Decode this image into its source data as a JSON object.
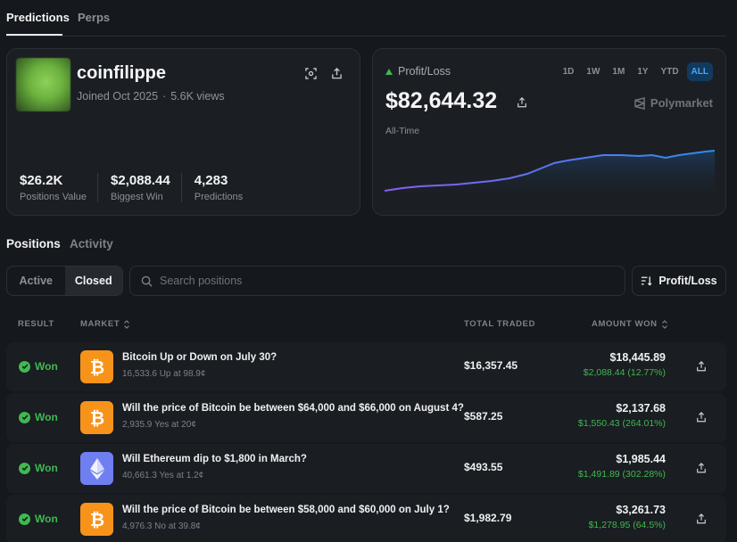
{
  "tabs": [
    {
      "label": "Predictions"
    },
    {
      "label": "Perps"
    }
  ],
  "profile": {
    "username": "coinfilippe",
    "joined": "Joined Oct 2025",
    "views": "5.6K views",
    "stats": [
      {
        "value": "$26.2K",
        "label": "Positions Value"
      },
      {
        "value": "$2,088.44",
        "label": "Biggest Win"
      },
      {
        "value": "4,283",
        "label": "Predictions"
      }
    ]
  },
  "pnl": {
    "label": "Profit/Loss",
    "value": "$82,644.32",
    "period": "All-Time",
    "brand": "Polymarket",
    "ranges": [
      "1D",
      "1W",
      "1M",
      "1Y",
      "YTD",
      "ALL"
    ],
    "active_range": "ALL",
    "colors": {
      "line_start": "#8a5cf6",
      "line_end": "#2f8cf0",
      "up": "#3fb950"
    }
  },
  "sections": [
    {
      "label": "Positions"
    },
    {
      "label": "Activity"
    }
  ],
  "filter": {
    "options": [
      "Active",
      "Closed"
    ],
    "selected": "Closed"
  },
  "search": {
    "placeholder": "Search positions"
  },
  "sort": {
    "label": "Profit/Loss"
  },
  "table": {
    "headers": {
      "result": "RESULT",
      "market": "MARKET",
      "traded": "TOTAL TRADED",
      "won": "AMOUNT WON"
    },
    "rows": [
      {
        "result": "Won",
        "icon": "bitcoin-icon",
        "title": "Bitcoin Up or Down on July 30?",
        "sub": "16,533.6 Up at 98.9¢",
        "traded": "$16,357.45",
        "amount": "$18,445.89",
        "gain": "$2,088.44 (12.77%)"
      },
      {
        "result": "Won",
        "icon": "bitcoin-icon",
        "title": "Will the price of Bitcoin be between $64,000 and $66,000 on August 4?",
        "sub": "2,935.9 Yes at 20¢",
        "traded": "$587.25",
        "amount": "$2,137.68",
        "gain": "$1,550.43 (264.01%)"
      },
      {
        "result": "Won",
        "icon": "ethereum-icon",
        "title": "Will Ethereum dip to $1,800 in March?",
        "sub": "40,661.3 Yes at 1.2¢",
        "traded": "$493.55",
        "amount": "$1,985.44",
        "gain": "$1,491.89 (302.28%)"
      },
      {
        "result": "Won",
        "icon": "bitcoin-icon",
        "title": "Will the price of Bitcoin be between $58,000 and $60,000 on July 1?",
        "sub": "4,976.3 No at 39.8¢",
        "traded": "$1,982.79",
        "amount": "$3,261.73",
        "gain": "$1,278.95 (64.5%)"
      }
    ]
  }
}
